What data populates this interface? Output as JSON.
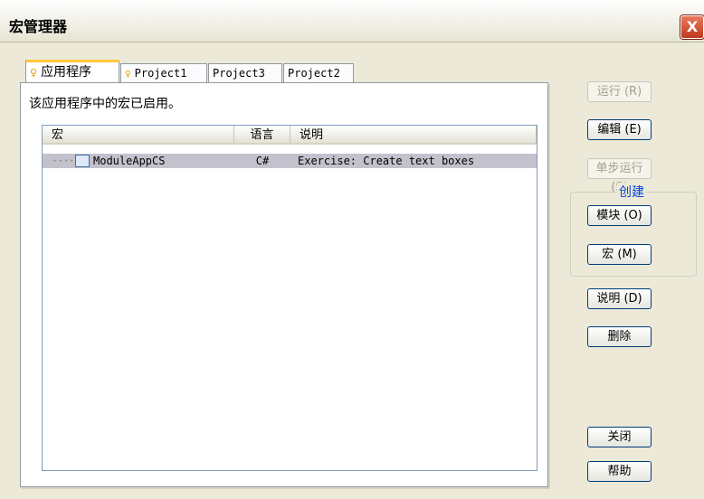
{
  "window": {
    "title": "宏管理器",
    "close_glyph": "X"
  },
  "tabs": [
    {
      "label": "应用程序",
      "active": true
    },
    {
      "label": "Project1",
      "active": false
    },
    {
      "label": "Project3",
      "active": false
    },
    {
      "label": "Project2",
      "active": false
    }
  ],
  "panel": {
    "info_text": "该应用程序中的宏已启用。"
  },
  "list": {
    "columns": [
      "宏",
      "语言",
      "说明"
    ],
    "rows": [
      {
        "name": "ModuleAppCS",
        "language": "C#",
        "description": "Exercise: Create text boxes",
        "selected": true
      }
    ]
  },
  "buttons": {
    "run": "运行 (R)",
    "edit": "编辑 (E)",
    "step": "单步运行 (S)",
    "create_group": "创建",
    "module": "模块 (O)",
    "macro": "宏 (M)",
    "describe": "说明 (D)",
    "delete": "删除",
    "close": "关闭",
    "help": "帮助"
  }
}
